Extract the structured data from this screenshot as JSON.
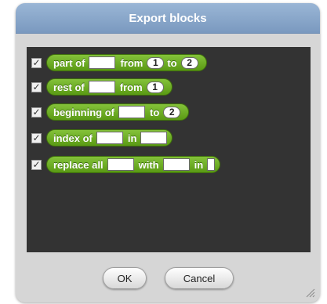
{
  "dialog": {
    "title": "Export blocks",
    "ok_label": "OK",
    "cancel_label": "Cancel"
  },
  "blocks": [
    {
      "checked": true,
      "check_glyph": "✓",
      "parts": [
        "part of",
        "from",
        "1",
        "to",
        "2"
      ]
    },
    {
      "checked": true,
      "check_glyph": "✓",
      "parts": [
        "rest of",
        "from",
        "1"
      ]
    },
    {
      "checked": true,
      "check_glyph": "✓",
      "parts": [
        "beginning of",
        "to",
        "2"
      ]
    },
    {
      "checked": true,
      "check_glyph": "✓",
      "parts": [
        "index of",
        "in"
      ]
    },
    {
      "checked": true,
      "check_glyph": "✓",
      "parts": [
        "replace all",
        "with",
        "in"
      ]
    }
  ],
  "colors": {
    "block_green": "#6fae24",
    "palette_bg": "#333333",
    "title_bar": "#8aa8cc"
  }
}
